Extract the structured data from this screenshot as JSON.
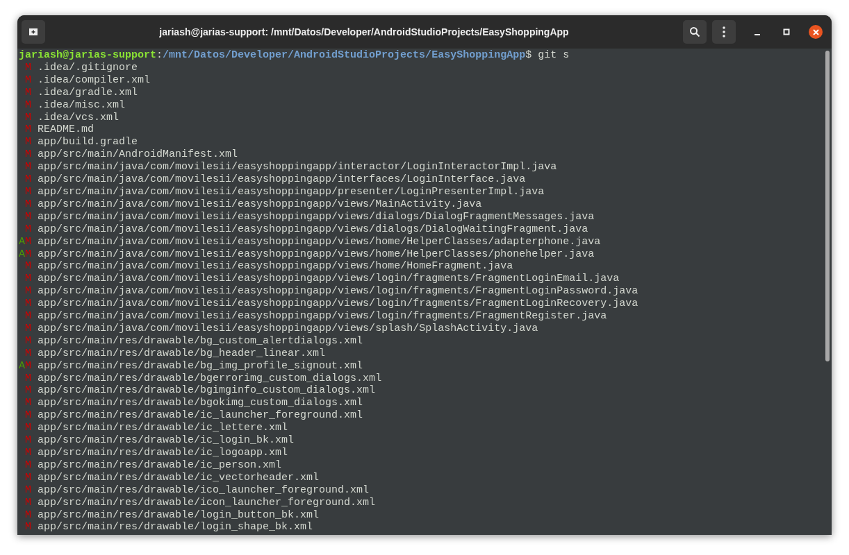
{
  "window": {
    "title": "jariash@jarias-support: /mnt/Datos/Developer/AndroidStudioProjects/EasyShoppingApp"
  },
  "prompt": {
    "user_host": "jariash@jarias-support",
    "separator": ":",
    "path": "/mnt/Datos/Developer/AndroidStudioProjects/EasyShoppingApp",
    "command": "$ git s"
  },
  "files": [
    {
      "status": " M",
      "path": ".idea/.gitignore"
    },
    {
      "status": " M",
      "path": ".idea/compiler.xml"
    },
    {
      "status": " M",
      "path": ".idea/gradle.xml"
    },
    {
      "status": " M",
      "path": ".idea/misc.xml"
    },
    {
      "status": " M",
      "path": ".idea/vcs.xml"
    },
    {
      "status": " M",
      "path": "README.md"
    },
    {
      "status": " M",
      "path": "app/build.gradle"
    },
    {
      "status": " M",
      "path": "app/src/main/AndroidManifest.xml"
    },
    {
      "status": " M",
      "path": "app/src/main/java/com/movilesii/easyshoppingapp/interactor/LoginInteractorImpl.java"
    },
    {
      "status": " M",
      "path": "app/src/main/java/com/movilesii/easyshoppingapp/interfaces/LoginInterface.java"
    },
    {
      "status": " M",
      "path": "app/src/main/java/com/movilesii/easyshoppingapp/presenter/LoginPresenterImpl.java"
    },
    {
      "status": " M",
      "path": "app/src/main/java/com/movilesii/easyshoppingapp/views/MainActivity.java"
    },
    {
      "status": " M",
      "path": "app/src/main/java/com/movilesii/easyshoppingapp/views/dialogs/DialogFragmentMessages.java"
    },
    {
      "status": " M",
      "path": "app/src/main/java/com/movilesii/easyshoppingapp/views/dialogs/DialogWaitingFragment.java"
    },
    {
      "status": "AM",
      "path": "app/src/main/java/com/movilesii/easyshoppingapp/views/home/HelperClasses/adapterphone.java"
    },
    {
      "status": "AM",
      "path": "app/src/main/java/com/movilesii/easyshoppingapp/views/home/HelperClasses/phonehelper.java"
    },
    {
      "status": " M",
      "path": "app/src/main/java/com/movilesii/easyshoppingapp/views/home/HomeFragment.java"
    },
    {
      "status": " M",
      "path": "app/src/main/java/com/movilesii/easyshoppingapp/views/login/fragments/FragmentLoginEmail.java"
    },
    {
      "status": " M",
      "path": "app/src/main/java/com/movilesii/easyshoppingapp/views/login/fragments/FragmentLoginPassword.java"
    },
    {
      "status": " M",
      "path": "app/src/main/java/com/movilesii/easyshoppingapp/views/login/fragments/FragmentLoginRecovery.java"
    },
    {
      "status": " M",
      "path": "app/src/main/java/com/movilesii/easyshoppingapp/views/login/fragments/FragmentRegister.java"
    },
    {
      "status": " M",
      "path": "app/src/main/java/com/movilesii/easyshoppingapp/views/splash/SplashActivity.java"
    },
    {
      "status": " M",
      "path": "app/src/main/res/drawable/bg_custom_alertdialogs.xml"
    },
    {
      "status": " M",
      "path": "app/src/main/res/drawable/bg_header_linear.xml"
    },
    {
      "status": "AM",
      "path": "app/src/main/res/drawable/bg_img_profile_signout.xml"
    },
    {
      "status": " M",
      "path": "app/src/main/res/drawable/bgerrorimg_custom_dialogs.xml"
    },
    {
      "status": " M",
      "path": "app/src/main/res/drawable/bgimginfo_custom_dialogs.xml"
    },
    {
      "status": " M",
      "path": "app/src/main/res/drawable/bgokimg_custom_dialogs.xml"
    },
    {
      "status": " M",
      "path": "app/src/main/res/drawable/ic_launcher_foreground.xml"
    },
    {
      "status": " M",
      "path": "app/src/main/res/drawable/ic_lettere.xml"
    },
    {
      "status": " M",
      "path": "app/src/main/res/drawable/ic_login_bk.xml"
    },
    {
      "status": " M",
      "path": "app/src/main/res/drawable/ic_logoapp.xml"
    },
    {
      "status": " M",
      "path": "app/src/main/res/drawable/ic_person.xml"
    },
    {
      "status": " M",
      "path": "app/src/main/res/drawable/ic_vectorheader.xml"
    },
    {
      "status": " M",
      "path": "app/src/main/res/drawable/ico_launcher_foreground.xml"
    },
    {
      "status": " M",
      "path": "app/src/main/res/drawable/icon_launcher_foreground.xml"
    },
    {
      "status": " M",
      "path": "app/src/main/res/drawable/login_button_bk.xml"
    },
    {
      "status": " M",
      "path": "app/src/main/res/drawable/login_shape_bk.xml"
    }
  ]
}
